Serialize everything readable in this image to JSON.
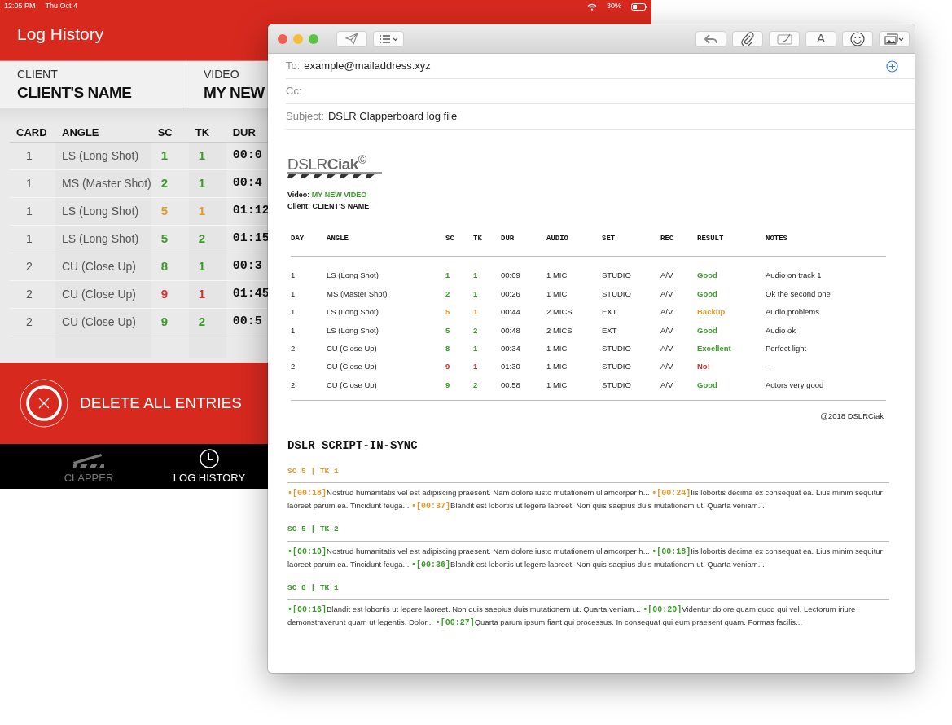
{
  "app": {
    "status_bar": {
      "time": "12:05 PM",
      "date": "Thu Oct 4",
      "battery": "30%"
    },
    "title": "Log History",
    "info": [
      {
        "label": "CLIENT",
        "value": "CLIENT'S NAME"
      },
      {
        "label": "VIDEO",
        "value": "MY NEW"
      }
    ],
    "table": {
      "columns": [
        "CARD",
        "ANGLE",
        "SC",
        "TK",
        "DUR"
      ],
      "rows": [
        {
          "card": "1",
          "angle": "LS (Long Shot)",
          "sc": "1",
          "tk": "1",
          "dur": "00:0",
          "color": "#3c9a2a"
        },
        {
          "card": "1",
          "angle": "MS (Master Shot)",
          "sc": "2",
          "tk": "1",
          "dur": "00:4",
          "color": "#3c9a2a"
        },
        {
          "card": "1",
          "angle": "LS (Long Shot)",
          "sc": "5",
          "tk": "1",
          "dur": "01:12",
          "color": "#e2992e"
        },
        {
          "card": "1",
          "angle": "LS (Long Shot)",
          "sc": "5",
          "tk": "2",
          "dur": "01:15",
          "color": "#3c9a2a"
        },
        {
          "card": "2",
          "angle": "CU (Close Up)",
          "sc": "8",
          "tk": "1",
          "dur": "00:3",
          "color": "#3c9a2a"
        },
        {
          "card": "2",
          "angle": "CU (Close Up)",
          "sc": "9",
          "tk": "1",
          "dur": "01:45",
          "color": "#d3302a"
        },
        {
          "card": "2",
          "angle": "CU (Close Up)",
          "sc": "9",
          "tk": "2",
          "dur": "00:5",
          "color": "#3c9a2a"
        }
      ]
    },
    "delete_button": "DELETE ALL ENTRIES",
    "tabs": [
      {
        "label": "CLAPPER",
        "selected": false,
        "kind": "clapper"
      },
      {
        "label": "LOG HISTORY",
        "selected": true,
        "kind": "clock"
      }
    ]
  },
  "mail": {
    "toolbar_left": [
      {
        "kind": "send"
      },
      {
        "kind": "list"
      }
    ],
    "toolbar_right": [
      {
        "kind": "reply"
      },
      {
        "kind": "attach"
      },
      {
        "kind": "markup"
      },
      {
        "kind": "font",
        "label": "A"
      },
      {
        "kind": "emoji"
      },
      {
        "kind": "photo"
      }
    ],
    "fields": [
      {
        "label": "To:",
        "value": "example@mailaddress.xyz"
      },
      {
        "label": "Cc:"
      },
      {
        "label": "Subject:",
        "value": "DSLR Clapperboard log file"
      }
    ],
    "body": {
      "logo": "DSLR**Ciak**$^{©}$",
      "video_label": "Video:",
      "video": "MY NEW VIDEO",
      "client_label": "Client:",
      "client": "CLIENT'S NAME",
      "table": {
        "columns": [
          "DAY",
          "ANGLE",
          "SC",
          "TK",
          "DUR",
          "AUDIO",
          "SET",
          "REC",
          "RESULT",
          "NOTES"
        ],
        "rows": [
          {
            "day": "1",
            "angle": "LS (Long Shot)",
            "sc": "1",
            "tk": "1",
            "dur": "00:09",
            "audio": "1 MIC",
            "set": "STUDIO",
            "rec": "A/V",
            "result": "Good",
            "notes": "Audio on track 1",
            "color": "#3c9a2a"
          },
          {
            "day": "1",
            "angle": "MS (Master Shot)",
            "sc": "2",
            "tk": "1",
            "dur": "00:26",
            "audio": "1 MIC",
            "set": "STUDIO",
            "rec": "A/V",
            "result": "Good",
            "notes": "Ok the second one",
            "color": "#3c9a2a"
          },
          {
            "day": "1",
            "angle": "LS (Long Shot)",
            "sc": "5",
            "tk": "1",
            "dur": "00:44",
            "audio": "2 MICS",
            "set": "EXT",
            "rec": "A/V",
            "result": "Backup",
            "notes": "Audio problems",
            "color": "#e2992e"
          },
          {
            "day": "1",
            "angle": "LS (Long Shot)",
            "sc": "5",
            "tk": "2",
            "dur": "00:48",
            "audio": "2 MICS",
            "set": "EXT",
            "rec": "A/V",
            "result": "Good",
            "notes": "Audio ok",
            "color": "#3c9a2a"
          },
          {
            "day": "2",
            "angle": "CU (Close Up)",
            "sc": "8",
            "tk": "1",
            "dur": "00:34",
            "audio": "1 MIC",
            "set": "STUDIO",
            "rec": "A/V",
            "result": "Excellent",
            "notes": "Perfect light",
            "color": "#3c9a2a"
          },
          {
            "day": "2",
            "angle": "CU (Close Up)",
            "sc": "9",
            "tk": "1",
            "dur": "01:30",
            "audio": "1 MIC",
            "set": "STUDIO",
            "rec": "A/V",
            "result": "No!",
            "notes": "--",
            "color": "#d3302a"
          },
          {
            "day": "2",
            "angle": "CU (Close Up)",
            "sc": "9",
            "tk": "2",
            "dur": "00:58",
            "audio": "1 MIC",
            "set": "STUDIO",
            "rec": "A/V",
            "result": "Good",
            "notes": "Actors very good",
            "color": "#3c9a2a"
          }
        ]
      },
      "footer": "@2018 DSLRCiak",
      "script_title": "DSLR SCRIPT-IN-SYNC",
      "script": [
        {
          "heading": "SC 5 | TK 1",
          "color": "#e2992e",
          "entries": [
            {
              "time": "•[00:18]",
              "text": "Nostrud humanitatis vel est adipiscing praesent. Nam dolore iusto mutationem ullamcorper h..."
            },
            {
              "time": "•[00:24]",
              "text": "Iis lobortis decima ex consequat ea. Lius minim sequitur laoreet parum ea. Tincidunt feuga..."
            },
            {
              "time": "•[00:37]",
              "text": "Blandit est lobortis ut legere laoreet. Non quis saepius duis mutationem ut. Quarta veniam..."
            }
          ]
        },
        {
          "heading": "SC 5 | TK 2",
          "color": "#3c9a2a",
          "entries": [
            {
              "time": "•[00:10]",
              "text": "Nostrud humanitatis vel est adipiscing praesent. Nam dolore iusto mutationem ullamcorper h..."
            },
            {
              "time": "•[00:18]",
              "text": "Iis lobortis decima ex consequat ea. Lius minim sequitur laoreet parum ea. Tincidunt feuga..."
            },
            {
              "time": "•[00:36]",
              "text": "Blandit est lobortis ut legere laoreet. Non quis saepius duis mutationem ut. Quarta veniam..."
            }
          ]
        },
        {
          "heading": "SC 8 | TK 1",
          "color": "#3c9a2a",
          "entries": [
            {
              "time": "•[00:16]",
              "text": "Blandit est lobortis ut legere laoreet. Non quis saepius duis mutationem ut. Quarta veniam..."
            },
            {
              "time": "•[00:20]",
              "text": "Videntur dolore quam quod qui vel. Lectorum iriure demonstraverunt quam ut legentis. Dolor..."
            },
            {
              "time": "•[00:27]",
              "text": "Quarta parum ipsum fiant qui processus. In consequat qui eum praesent quam. Formas facilis..."
            }
          ]
        }
      ]
    }
  }
}
